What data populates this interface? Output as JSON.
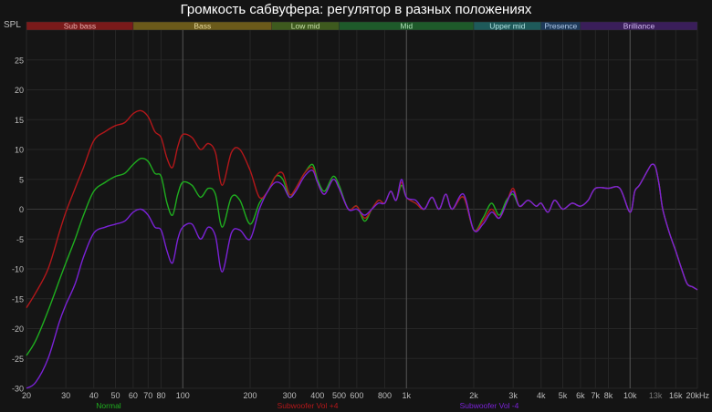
{
  "chart_data": {
    "type": "line",
    "title": "Громкость сабвуфера: регулятор в разных положениях",
    "ylabel": "SPL",
    "x_scale": "log",
    "xlim": [
      20,
      20000
    ],
    "ylim": [
      -30,
      30
    ],
    "grid": true,
    "y_ticks": [
      25,
      20,
      15,
      10,
      5,
      0,
      -5,
      -10,
      -15,
      -20,
      -25,
      -30
    ],
    "x_ticks": [
      {
        "value": 20,
        "label": "20"
      },
      {
        "value": 30,
        "label": "30"
      },
      {
        "value": 40,
        "label": "40"
      },
      {
        "value": 50,
        "label": "50"
      },
      {
        "value": 60,
        "label": "60"
      },
      {
        "value": 70,
        "label": "70"
      },
      {
        "value": 80,
        "label": "80"
      },
      {
        "value": 100,
        "label": "100"
      },
      {
        "value": 200,
        "label": "200"
      },
      {
        "value": 300,
        "label": "300"
      },
      {
        "value": 400,
        "label": "400"
      },
      {
        "value": 500,
        "label": "500"
      },
      {
        "value": 600,
        "label": "600"
      },
      {
        "value": 800,
        "label": "800"
      },
      {
        "value": 1000,
        "label": "1k"
      },
      {
        "value": 2000,
        "label": "2k"
      },
      {
        "value": 3000,
        "label": "3k"
      },
      {
        "value": 4000,
        "label": "4k"
      },
      {
        "value": 5000,
        "label": "5k"
      },
      {
        "value": 6000,
        "label": "6k"
      },
      {
        "value": 7000,
        "label": "7k"
      },
      {
        "value": 8000,
        "label": "8k"
      },
      {
        "value": 10000,
        "label": "10k"
      },
      {
        "value": 13000,
        "label": "13k"
      },
      {
        "value": 16000,
        "label": "16k"
      },
      {
        "value": 20000,
        "label": "20kHz"
      }
    ],
    "bands": [
      {
        "label": "Sub bass",
        "from": 20,
        "to": 60,
        "color": "#7a1a1a",
        "text_color": "#e8b0b0"
      },
      {
        "label": "Bass",
        "from": 60,
        "to": 250,
        "color": "#6b5a1a",
        "text_color": "#e8dca0"
      },
      {
        "label": "Low mid",
        "from": 250,
        "to": 500,
        "color": "#3e5a1e",
        "text_color": "#c8e0a8"
      },
      {
        "label": "Mid",
        "from": 500,
        "to": 2000,
        "color": "#1e5a2a",
        "text_color": "#b0e0b8"
      },
      {
        "label": "Upper mid",
        "from": 2000,
        "to": 4000,
        "color": "#1e5a5a",
        "text_color": "#b0e0e0"
      },
      {
        "label": "Presence",
        "from": 4000,
        "to": 6000,
        "color": "#1e3a5a",
        "text_color": "#b0c8e8"
      },
      {
        "label": "Brilliance",
        "from": 6000,
        "to": 20000,
        "color": "#3a1e5a",
        "text_color": "#d0b8f0"
      }
    ],
    "series": [
      {
        "name": "Normal",
        "color": "#1fae1f",
        "x": [
          20,
          22,
          25,
          28,
          30,
          33,
          36,
          40,
          45,
          50,
          55,
          60,
          65,
          70,
          75,
          80,
          85,
          90,
          95,
          100,
          110,
          120,
          130,
          140,
          150,
          165,
          180,
          200,
          220,
          240,
          260,
          280,
          300,
          320,
          350,
          380,
          400,
          430,
          470,
          500,
          550,
          600,
          650,
          700,
          750,
          800,
          850,
          900,
          950,
          1000,
          1100,
          1200,
          1300,
          1400,
          1500,
          1600,
          1800,
          2000,
          2200,
          2400,
          2600,
          2800,
          3000,
          3200,
          3500,
          3800,
          4000,
          4300,
          4600,
          5000,
          5500,
          6000,
          6500,
          7000,
          8000,
          9000,
          10000,
          10500,
          11000,
          12000,
          12500,
          13000,
          13500,
          14000,
          15000,
          16000,
          17000,
          18000,
          19000,
          20000
        ],
        "y": [
          -24.5,
          -22,
          -17,
          -12,
          -9,
          -5,
          -1,
          3,
          4.5,
          5.5,
          6,
          7.5,
          8.5,
          8,
          6,
          5.5,
          1,
          -1,
          2.5,
          4.5,
          4,
          2,
          3.5,
          2.5,
          -3,
          2,
          1.5,
          -2.5,
          1,
          3,
          5.5,
          5,
          2,
          3.5,
          6,
          7.5,
          5,
          3,
          5.5,
          4,
          0,
          0.5,
          -2,
          0,
          1.5,
          1,
          3,
          1.5,
          4,
          2,
          1,
          0,
          2,
          0,
          2.5,
          0,
          2,
          -3.5,
          -1.5,
          1,
          -1,
          1.5,
          2.5,
          0.5,
          1.5,
          0.5,
          1,
          -0.5,
          1.5,
          0,
          1,
          0.5,
          1.5,
          3.5,
          3.5,
          3.5,
          -0.5,
          3,
          4,
          6.5,
          7.5,
          7,
          4,
          0,
          -4,
          -7,
          -10,
          -12.5,
          -13,
          -13.5
        ]
      },
      {
        "name": "Subwoofer Vol +4",
        "color": "#b3171a",
        "x": [
          20,
          22,
          25,
          28,
          30,
          33,
          36,
          40,
          45,
          50,
          55,
          60,
          65,
          70,
          75,
          80,
          85,
          90,
          95,
          100,
          110,
          120,
          130,
          140,
          150,
          165,
          180,
          200,
          220,
          240,
          260,
          280,
          300,
          320,
          350,
          380,
          400,
          430,
          470,
          500,
          550,
          600,
          650,
          700,
          750,
          800,
          850,
          900,
          950,
          1000,
          1100,
          1200,
          1300,
          1400,
          1500,
          1600,
          1800,
          2000,
          2200,
          2400,
          2600,
          2800,
          3000,
          3200,
          3500,
          3800,
          4000,
          4300,
          4600,
          5000,
          5500,
          6000,
          6500,
          7000,
          8000,
          9000,
          10000,
          10500,
          11000,
          12000,
          12500,
          13000,
          13500,
          14000,
          15000,
          16000,
          17000,
          18000,
          19000,
          20000
        ],
        "y": [
          -16.5,
          -14,
          -10,
          -4,
          -0.5,
          3.5,
          7,
          11.5,
          13,
          14,
          14.5,
          16,
          16.5,
          15.5,
          13,
          12,
          8.5,
          7,
          10.5,
          12.5,
          12,
          10,
          11,
          9.5,
          4,
          9.5,
          10,
          6.5,
          2,
          3,
          5.5,
          6,
          2.5,
          3.5,
          6,
          7,
          4.5,
          2.5,
          5,
          3.5,
          0,
          0.5,
          -1.5,
          0,
          1.5,
          1,
          3,
          1.5,
          4.5,
          2,
          1,
          0,
          2,
          0,
          2.5,
          0,
          2,
          -3.5,
          -2,
          0,
          -1.5,
          1,
          3.5,
          0.5,
          1.5,
          0.5,
          1,
          -0.5,
          1.5,
          0,
          1,
          0.5,
          1.5,
          3.5,
          3.5,
          3.5,
          -0.5,
          3,
          4,
          6.5,
          7.5,
          7,
          4,
          0,
          -4,
          -7,
          -10,
          -12.5,
          -13,
          -13.5
        ]
      },
      {
        "name": "Subwoofer Vol -4",
        "color": "#7a22d6",
        "x": [
          20,
          22,
          25,
          28,
          30,
          33,
          36,
          40,
          45,
          50,
          55,
          60,
          65,
          70,
          75,
          80,
          85,
          90,
          95,
          100,
          110,
          120,
          130,
          140,
          150,
          165,
          180,
          200,
          220,
          240,
          260,
          280,
          300,
          320,
          350,
          380,
          400,
          430,
          470,
          500,
          550,
          600,
          650,
          700,
          750,
          800,
          850,
          900,
          950,
          1000,
          1100,
          1200,
          1300,
          1400,
          1500,
          1600,
          1800,
          2000,
          2200,
          2400,
          2600,
          2800,
          3000,
          3200,
          3500,
          3800,
          4000,
          4300,
          4600,
          5000,
          5500,
          6000,
          6500,
          7000,
          8000,
          9000,
          10000,
          10500,
          11000,
          12000,
          12500,
          13000,
          13500,
          14000,
          15000,
          16000,
          17000,
          18000,
          19000,
          20000
        ],
        "y": [
          -30,
          -29,
          -25,
          -19,
          -16,
          -12.5,
          -8,
          -4,
          -3,
          -2.5,
          -2,
          -0.5,
          0,
          -1,
          -3,
          -3.5,
          -7,
          -9,
          -5,
          -3,
          -2.5,
          -5,
          -3,
          -4.5,
          -10.5,
          -4,
          -3.5,
          -5,
          0,
          3,
          4.5,
          4,
          2,
          3,
          5.5,
          6.5,
          4.5,
          2.5,
          5,
          3.5,
          0,
          0,
          -1,
          0,
          1,
          1,
          3,
          1.5,
          5,
          2,
          1.5,
          0,
          2,
          0,
          2.5,
          0,
          2.5,
          -3.5,
          -2.5,
          -0.5,
          -1.5,
          1,
          3,
          0.5,
          1.5,
          0.5,
          1,
          -0.5,
          1.5,
          0,
          1,
          0.5,
          1.5,
          3.5,
          3.5,
          3.5,
          -0.5,
          3,
          4,
          6.5,
          7.5,
          7,
          4,
          0,
          -4,
          -7,
          -10,
          -12.5,
          -13,
          -13.5
        ]
      }
    ]
  }
}
